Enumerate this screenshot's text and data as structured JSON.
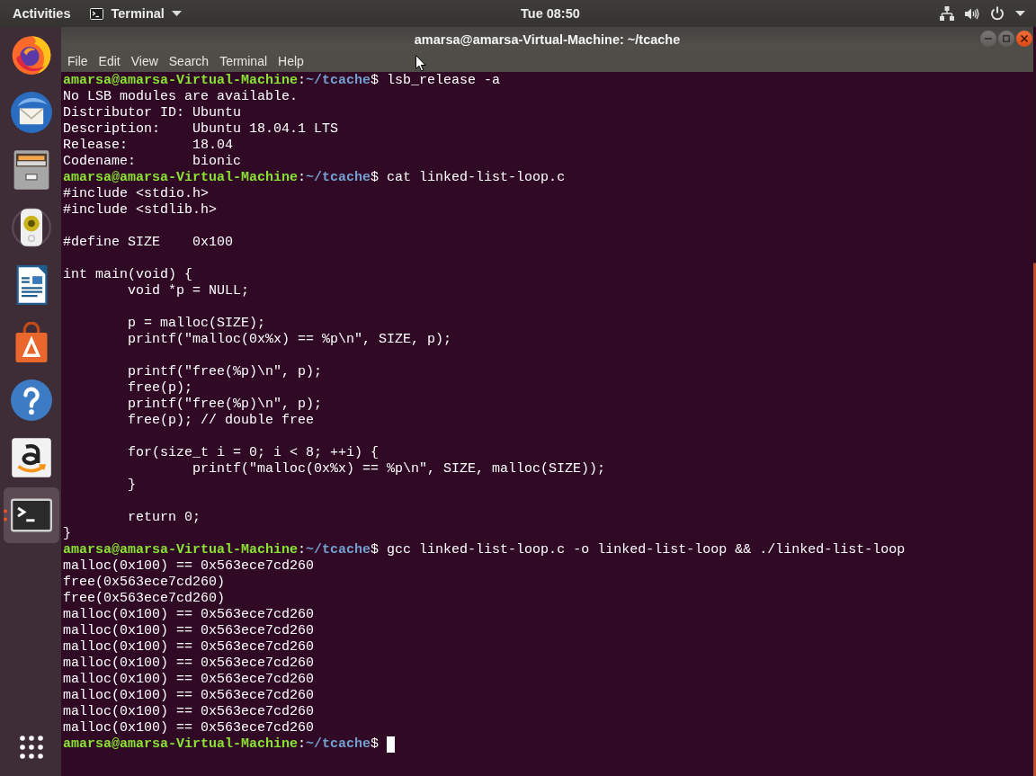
{
  "top_bar": {
    "activities": "Activities",
    "app_menu": "Terminal",
    "clock": "Tue 08:50"
  },
  "dock": {
    "items": [
      {
        "kind": "browser",
        "selected": false,
        "running": false
      },
      {
        "kind": "mail",
        "selected": false,
        "running": false
      },
      {
        "kind": "files",
        "selected": false,
        "running": false
      },
      {
        "kind": "music",
        "selected": false,
        "running": false
      },
      {
        "kind": "writer",
        "selected": false,
        "running": false
      },
      {
        "kind": "software",
        "selected": false,
        "running": false
      },
      {
        "kind": "help",
        "selected": false,
        "running": false
      },
      {
        "kind": "store",
        "selected": false,
        "running": false
      },
      {
        "kind": "terminal",
        "selected": true,
        "running": true
      }
    ]
  },
  "window": {
    "title": "amarsa@amarsa-Virtual-Machine: ~/tcache",
    "menu": [
      "File",
      "Edit",
      "View",
      "Search",
      "Terminal",
      "Help"
    ]
  },
  "terminal": {
    "lines": [
      {
        "kind": "prompt",
        "user_host": "amarsa@amarsa-Virtual-Machine",
        "sep": ":",
        "path": "~/tcache",
        "sign": "$",
        "command": "lsb_release -a",
        "cursor": false
      },
      {
        "kind": "output",
        "text": "No LSB modules are available."
      },
      {
        "kind": "output",
        "text": "Distributor ID: Ubuntu"
      },
      {
        "kind": "output",
        "text": "Description:    Ubuntu 18.04.1 LTS"
      },
      {
        "kind": "output",
        "text": "Release:        18.04"
      },
      {
        "kind": "output",
        "text": "Codename:       bionic"
      },
      {
        "kind": "prompt",
        "user_host": "amarsa@amarsa-Virtual-Machine",
        "sep": ":",
        "path": "~/tcache",
        "sign": "$",
        "command": "cat linked-list-loop.c",
        "cursor": false
      },
      {
        "kind": "output",
        "text": "#include <stdio.h>"
      },
      {
        "kind": "output",
        "text": "#include <stdlib.h>"
      },
      {
        "kind": "blank"
      },
      {
        "kind": "output",
        "text": "#define SIZE    0x100"
      },
      {
        "kind": "blank"
      },
      {
        "kind": "output",
        "text": "int main(void) {"
      },
      {
        "kind": "output",
        "text": "        void *p = NULL;"
      },
      {
        "kind": "blank"
      },
      {
        "kind": "output",
        "text": "        p = malloc(SIZE);"
      },
      {
        "kind": "output",
        "text": "        printf(\"malloc(0x%x) == %p\\n\", SIZE, p);"
      },
      {
        "kind": "blank"
      },
      {
        "kind": "output",
        "text": "        printf(\"free(%p)\\n\", p);"
      },
      {
        "kind": "output",
        "text": "        free(p);"
      },
      {
        "kind": "output",
        "text": "        printf(\"free(%p)\\n\", p);"
      },
      {
        "kind": "output",
        "text": "        free(p); // double free"
      },
      {
        "kind": "blank"
      },
      {
        "kind": "output",
        "text": "        for(size_t i = 0; i < 8; ++i) {"
      },
      {
        "kind": "output",
        "text": "                printf(\"malloc(0x%x) == %p\\n\", SIZE, malloc(SIZE));"
      },
      {
        "kind": "output",
        "text": "        }"
      },
      {
        "kind": "blank"
      },
      {
        "kind": "output",
        "text": "        return 0;"
      },
      {
        "kind": "output",
        "text": "}"
      },
      {
        "kind": "prompt",
        "user_host": "amarsa@amarsa-Virtual-Machine",
        "sep": ":",
        "path": "~/tcache",
        "sign": "$",
        "command": "gcc linked-list-loop.c -o linked-list-loop && ./linked-list-loop",
        "cursor": false
      },
      {
        "kind": "output",
        "text": "malloc(0x100) == 0x563ece7cd260"
      },
      {
        "kind": "output",
        "text": "free(0x563ece7cd260)"
      },
      {
        "kind": "output",
        "text": "free(0x563ece7cd260)"
      },
      {
        "kind": "output",
        "text": "malloc(0x100) == 0x563ece7cd260"
      },
      {
        "kind": "output",
        "text": "malloc(0x100) == 0x563ece7cd260"
      },
      {
        "kind": "output",
        "text": "malloc(0x100) == 0x563ece7cd260"
      },
      {
        "kind": "output",
        "text": "malloc(0x100) == 0x563ece7cd260"
      },
      {
        "kind": "output",
        "text": "malloc(0x100) == 0x563ece7cd260"
      },
      {
        "kind": "output",
        "text": "malloc(0x100) == 0x563ece7cd260"
      },
      {
        "kind": "output",
        "text": "malloc(0x100) == 0x563ece7cd260"
      },
      {
        "kind": "output",
        "text": "malloc(0x100) == 0x563ece7cd260"
      },
      {
        "kind": "prompt",
        "user_host": "amarsa@amarsa-Virtual-Machine",
        "sep": ":",
        "path": "~/tcache",
        "sign": "$",
        "cursor": true
      }
    ]
  }
}
